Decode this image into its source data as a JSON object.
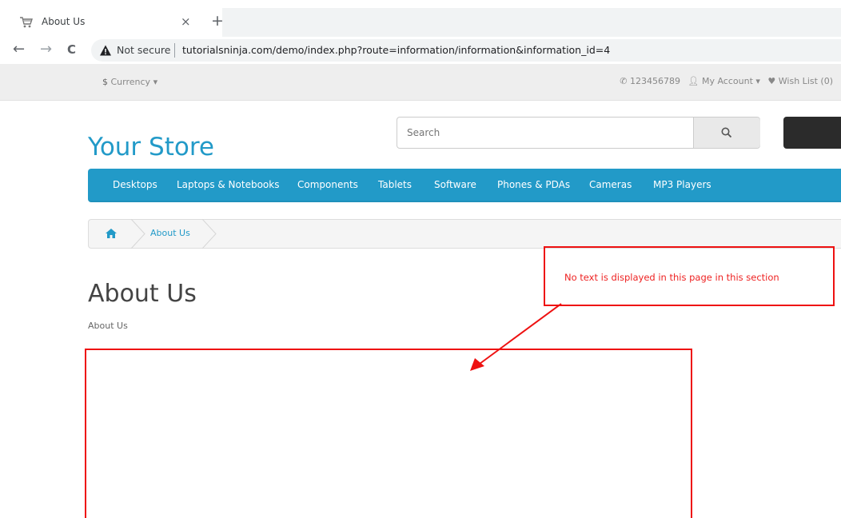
{
  "browser": {
    "tab_title": "About Us",
    "tab_close": "×",
    "new_tab": "+",
    "back": "←",
    "forward": "→",
    "reload": "C",
    "not_secure": "Not secure",
    "url": "tutorialsninja.com/demo/index.php?route=information/information&information_id=4"
  },
  "topbar": {
    "currency_symbol": "$",
    "currency_label": "Currency",
    "phone": "123456789",
    "my_account": "My Account",
    "wish_list": "Wish List (0)"
  },
  "header": {
    "logo": "Your Store",
    "search_placeholder": "Search"
  },
  "menu": [
    "Desktops",
    "Laptops & Notebooks",
    "Components",
    "Tablets",
    "Software",
    "Phones & PDAs",
    "Cameras",
    "MP3 Players"
  ],
  "breadcrumb": {
    "current": "About Us"
  },
  "content": {
    "title": "About Us",
    "subtitle": "About Us"
  },
  "annotation": {
    "text": "No text is displayed in this page in this section",
    "color": "#ee1111"
  },
  "colors": {
    "brand": "#229ac8"
  }
}
